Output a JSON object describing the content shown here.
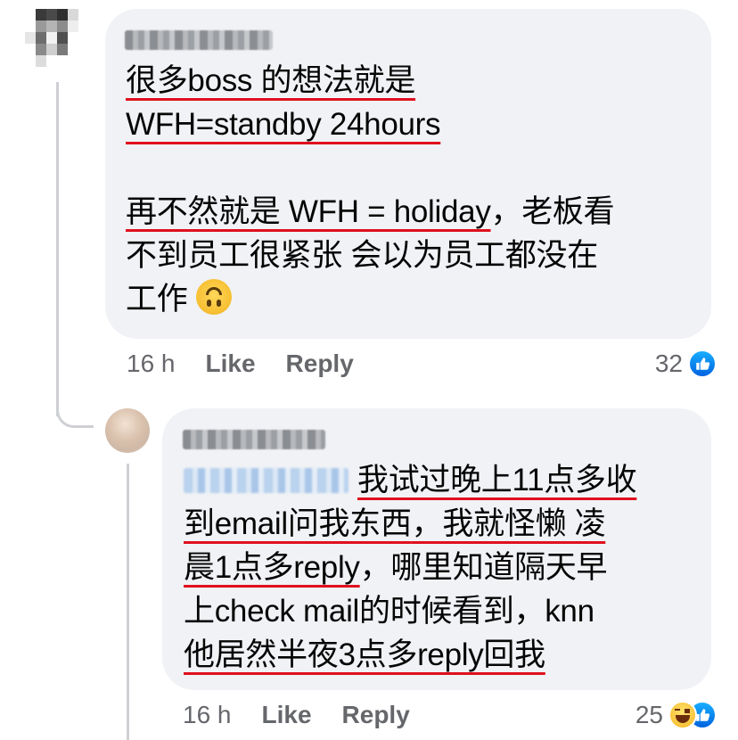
{
  "comment1": {
    "lines": [
      "很多boss 的想法就是",
      "WFH=standby 24hours",
      "",
      "再不然就是 WFH = holiday",
      "，老板看",
      "不到员工很紧张 会以为员工都没在",
      "工作"
    ],
    "emoji": "upside-down-face",
    "time": "16 h",
    "like_label": "Like",
    "reply_label": "Reply",
    "reaction_count": "32",
    "reaction_icons": [
      "like-icon"
    ]
  },
  "comment2": {
    "segments": {
      "l1": "我试过晚上11点多收",
      "l2a": "到email问我东西",
      "l2b": "，我就怪懒 凌",
      "l3a": "晨1点多reply",
      "l3b": "，哪里知道隔天早",
      "l4": "上check mail的时候看到，knn",
      "l5": "他居然半夜3点多reply回我"
    },
    "time": "16 h",
    "like_label": "Like",
    "reply_label": "Reply",
    "reaction_count": "25",
    "reaction_icons": [
      "haha-icon",
      "like-icon"
    ]
  },
  "colors": {
    "bubble": "#f0f2f5",
    "underline": "#e0101e",
    "meta_text": "#65676b",
    "like_blue": "#0866ff"
  }
}
